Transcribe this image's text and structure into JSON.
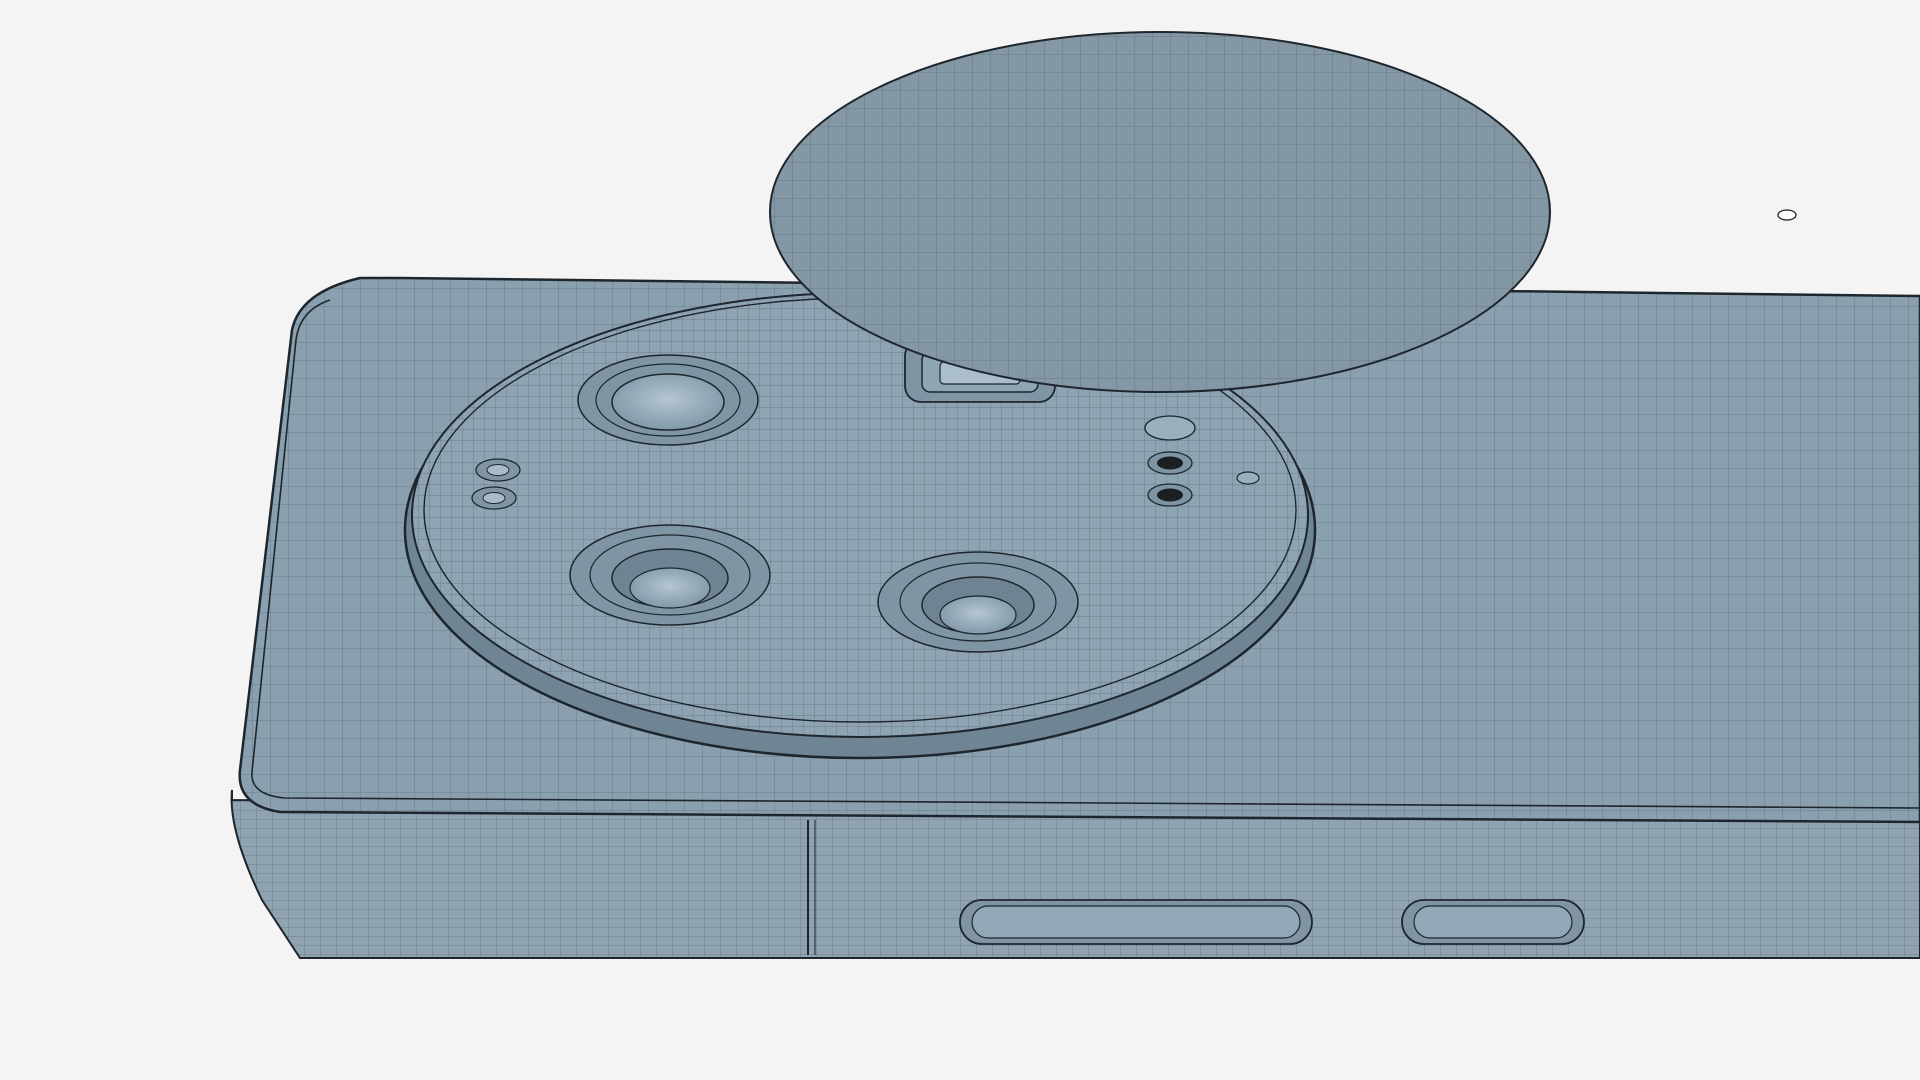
{
  "scene": {
    "background": "#f4f4f4",
    "body_color": "#7f93a1",
    "body_top_color": "#8aa0ae",
    "body_side_color": "#8fa3b1",
    "mesh_line_color": "#2f3b45",
    "outline_color": "#1e262d",
    "lens_color": "#9bb0bd",
    "dark_hole_color": "#1a1f24",
    "disc_color": "#8497a4"
  },
  "objects": {
    "phone_body": {
      "kind": "smartphone-wireframe-model"
    },
    "camera_module": {
      "lenses": [
        "lens-top-left",
        "lens-bottom-left",
        "lens-bottom-right"
      ],
      "periscope": "periscope-window",
      "small_sensors": [
        "sensor-left-top",
        "sensor-left-bottom",
        "sensor-right-top",
        "sensor-right-dark-1",
        "sensor-right-dark-2",
        "sensor-right-small"
      ]
    },
    "detached_disc": {
      "kind": "camera-cover-disc",
      "pin_hole": true
    },
    "side_buttons": [
      "volume-button",
      "power-button"
    ]
  }
}
